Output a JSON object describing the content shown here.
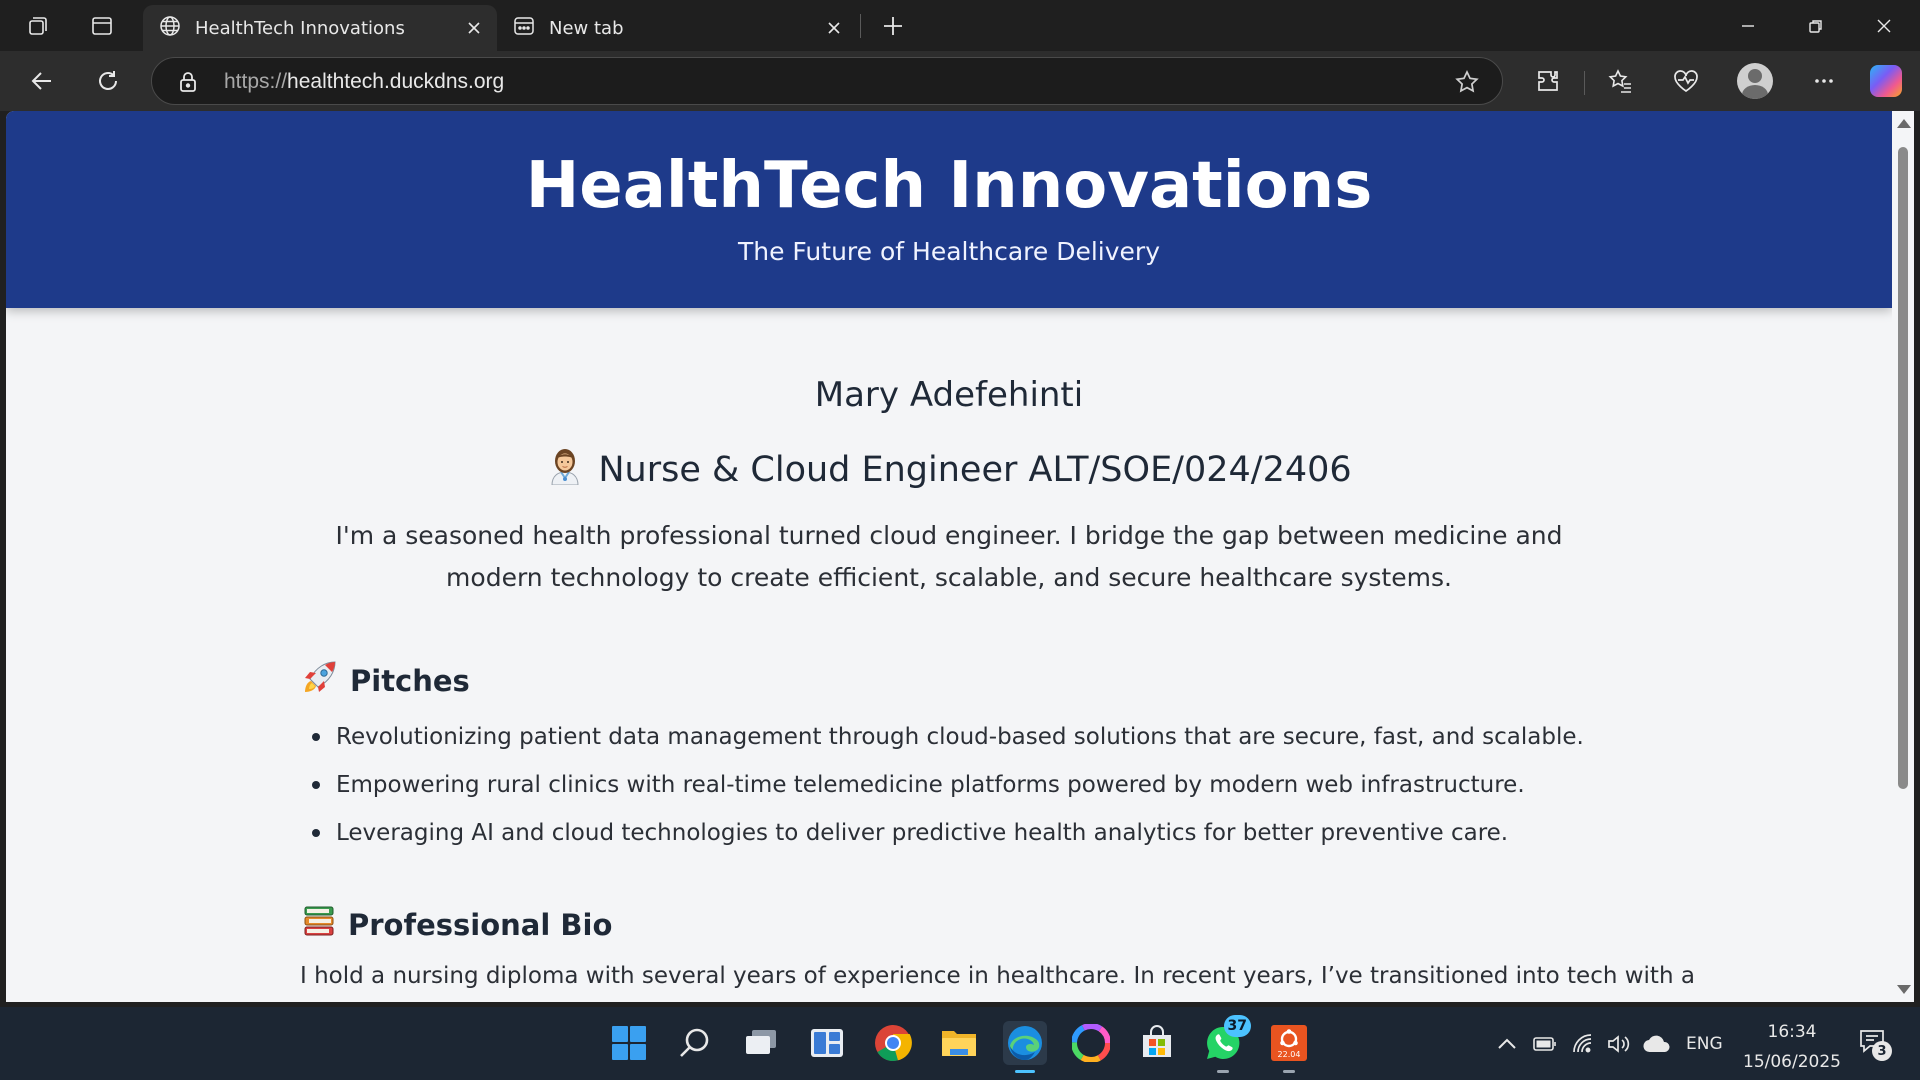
{
  "browser": {
    "tabs": [
      {
        "title": "HealthTech Innovations",
        "icon": "globe-icon",
        "active": true
      },
      {
        "title": "New tab",
        "icon": "newtab-icon",
        "active": false
      }
    ],
    "address": {
      "scheme": "https://",
      "host": "healthtech.duckdns.org"
    }
  },
  "page": {
    "hero": {
      "title": "HealthTech Innovations",
      "subtitle": "The Future of Healthcare Delivery",
      "background": "#1e3a8a"
    },
    "profile": {
      "name": "Mary Adefehinti",
      "role": "Nurse & Cloud Engineer ALT/SOE/024/2406",
      "role_icon": "nurse-emoji-icon",
      "intro": "I'm a seasoned health professional turned cloud engineer. I bridge the gap between medicine and modern technology to create efficient, scalable, and secure healthcare systems."
    },
    "pitches": {
      "heading": "Pitches",
      "icon": "rocket-icon",
      "items": [
        "Revolutionizing patient data management through cloud-based solutions that are secure, fast, and scalable.",
        "Empowering rural clinics with real-time telemedicine platforms powered by modern web infrastructure.",
        "Leveraging AI and cloud technologies to deliver predictive health analytics for better preventive care."
      ]
    },
    "bio": {
      "heading": "Professional Bio",
      "icon": "books-icon",
      "text": "I hold a nursing diploma with several years of experience in healthcare. In recent years, I’ve transitioned into tech with a"
    }
  },
  "taskbar": {
    "whatsapp_badge": "37",
    "ubuntu_label": "22.04",
    "language": "ENG",
    "time": "16:34",
    "date": "15/06/2025",
    "notifications": "3"
  }
}
